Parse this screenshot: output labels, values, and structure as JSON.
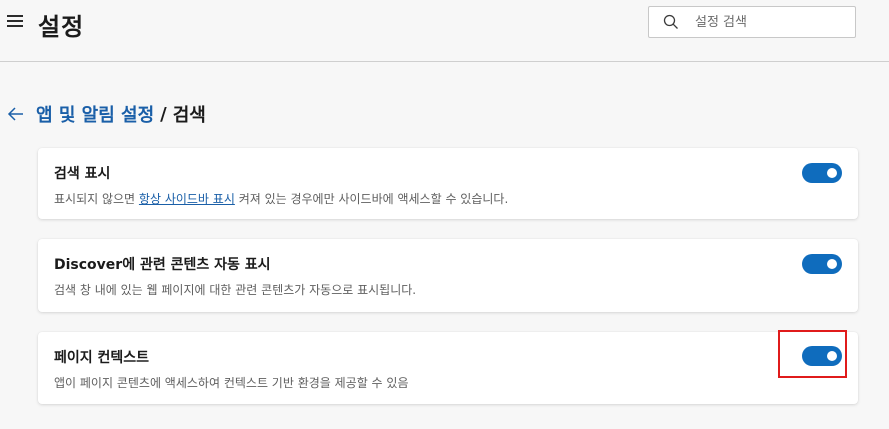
{
  "header": {
    "title": "설정",
    "search_placeholder": "설정 검색"
  },
  "breadcrumb": {
    "parent": "앱 및 알림 설정",
    "separator": "/",
    "current": "검색"
  },
  "settings": [
    {
      "title": "검색 표시",
      "desc_before": "표시되지 않으면 ",
      "desc_link": "항상 사이드바 표시",
      "desc_after": " 켜져 있는 경우에만 사이드바에 액세스할 수 있습니다.",
      "enabled": true
    },
    {
      "title": "Discover에 관련 콘텐츠 자동 표시",
      "desc": "검색 창 내에 있는 웹 페이지에 대한 관련 콘텐츠가 자동으로 표시됩니다.",
      "enabled": true
    },
    {
      "title": "페이지 컨텍스트",
      "desc": "앱이 페이지 콘텐츠에 액세스하여 컨텍스트 기반 환경을 제공할 수 있음",
      "enabled": true
    }
  ],
  "colors": {
    "accent": "#0f6cbd",
    "link": "#1a5fa8",
    "highlight": "#e01b1b"
  }
}
